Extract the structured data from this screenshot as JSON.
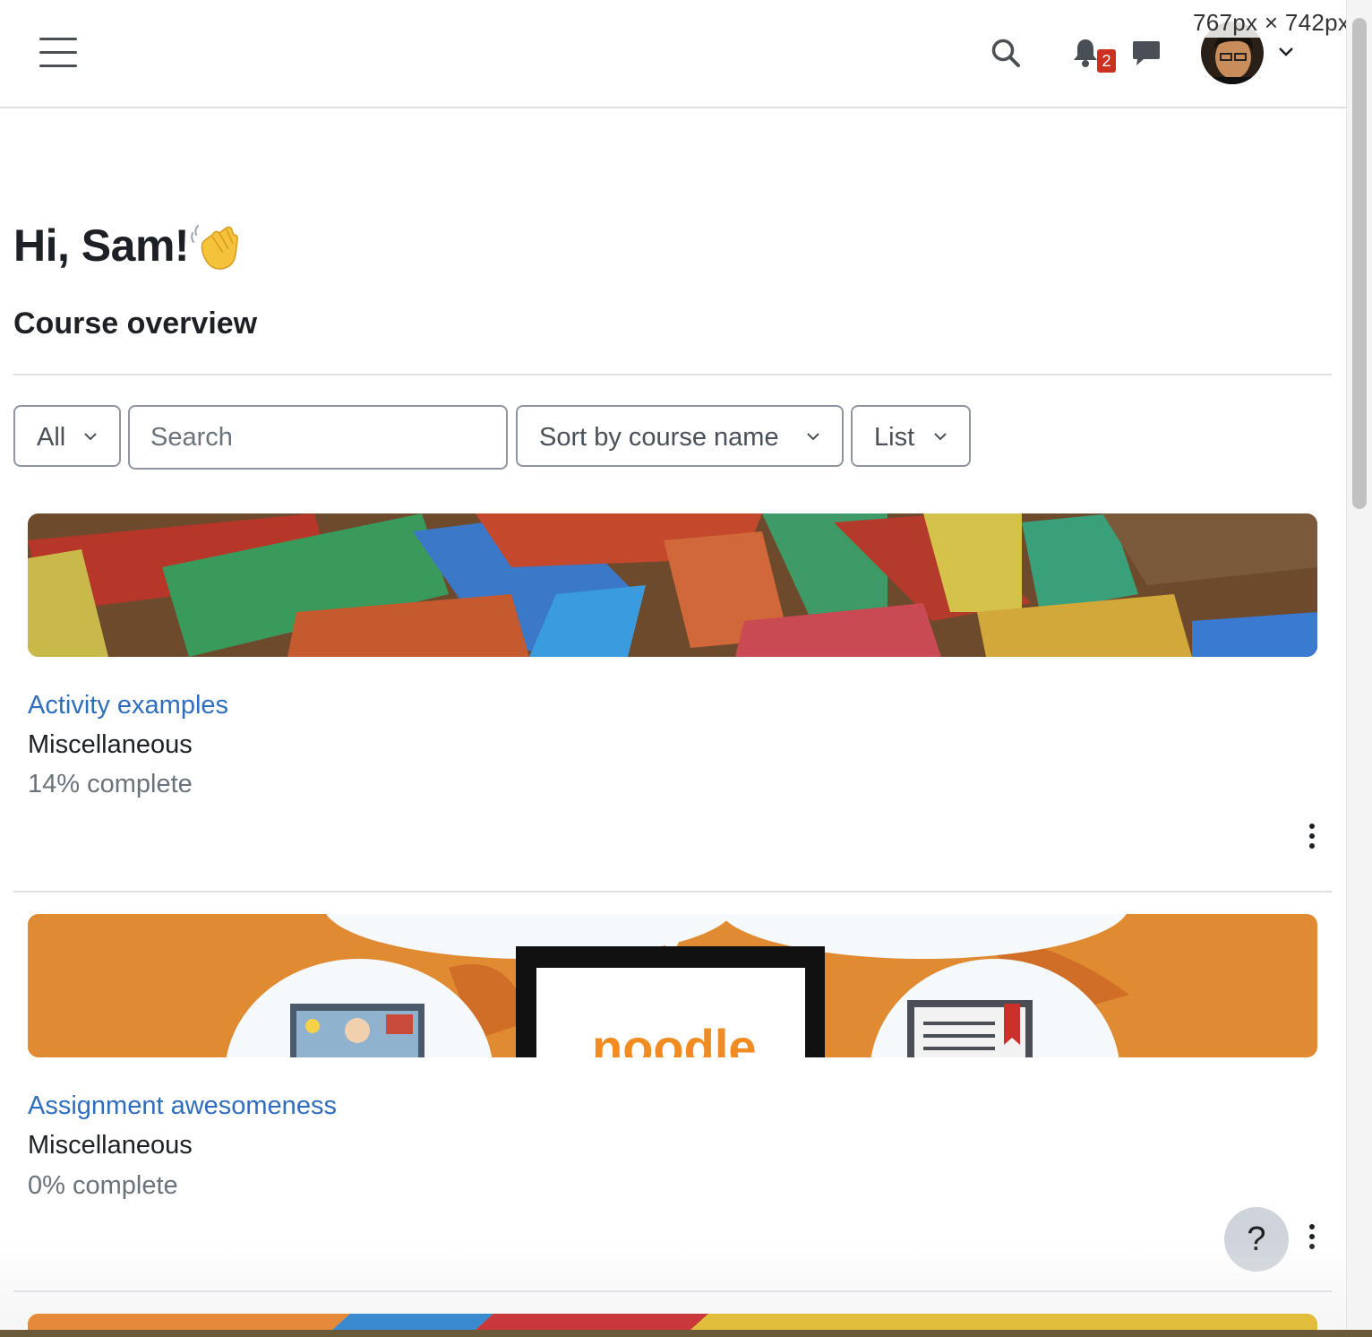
{
  "overlay": {
    "size_readout": "767px × 742px"
  },
  "navbar": {
    "notification_count": "2"
  },
  "page": {
    "greeting": "Hi, Sam!",
    "section_title": "Course overview"
  },
  "filters": {
    "grouping_label": "All",
    "search_placeholder": "Search",
    "sort_label": "Sort by course name",
    "view_label": "List"
  },
  "courses": [
    {
      "name": "Activity examples",
      "category": "Miscellaneous",
      "progress_text": "14% complete",
      "progress_percent": 14
    },
    {
      "name": "Assignment awesomeness",
      "category": "Miscellaneous",
      "progress_text": "0% complete",
      "progress_percent": 0
    }
  ],
  "help": {
    "label": "?"
  },
  "icons": {
    "menu": "hamburger-icon",
    "search": "search-icon",
    "notifications": "bell-icon",
    "messages": "chat-bubble-icon",
    "user_menu": "chevron-down-icon",
    "course_actions": "kebab-menu-icon",
    "greeting": "waving-hand-icon"
  },
  "colors": {
    "link": "#2f6ebd",
    "badge": "#ca3120",
    "muted_text": "#6a737b",
    "border": "#8f959e"
  }
}
